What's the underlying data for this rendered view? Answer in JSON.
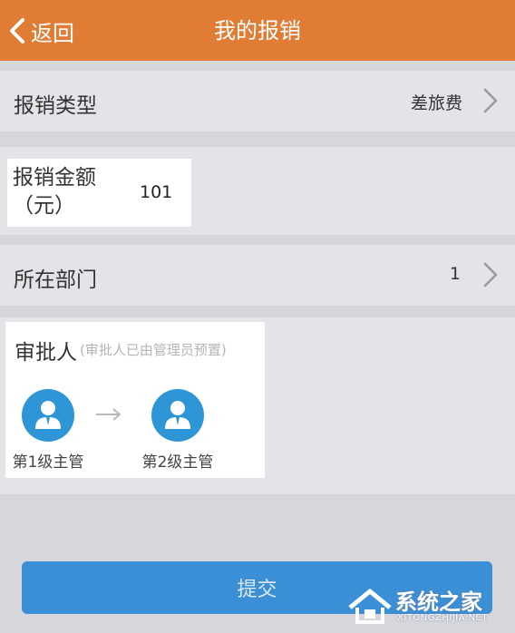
{
  "header": {
    "back_label": "返回",
    "title": "我的报销",
    "background": "#e07c34"
  },
  "reimbursement_type": {
    "label": "报销类型",
    "value": "差旅费"
  },
  "amount": {
    "label": "报销金额（元）",
    "value": "101"
  },
  "department": {
    "label": "所在部门",
    "value": "1"
  },
  "approvers": {
    "title": "审批人",
    "hint": "(审批人已由管理员预置)",
    "nodes": [
      {
        "label": "第1级主管",
        "icon": "user-avatar-icon"
      },
      {
        "label": "第2级主管",
        "icon": "user-avatar-icon"
      }
    ],
    "arrow_icon": "arrow-right-icon"
  },
  "submit": {
    "label": "提交",
    "color": "#3a8fd6"
  },
  "watermark": {
    "text": "系统之家",
    "sub": "XITONGZHIJIA.NET"
  }
}
